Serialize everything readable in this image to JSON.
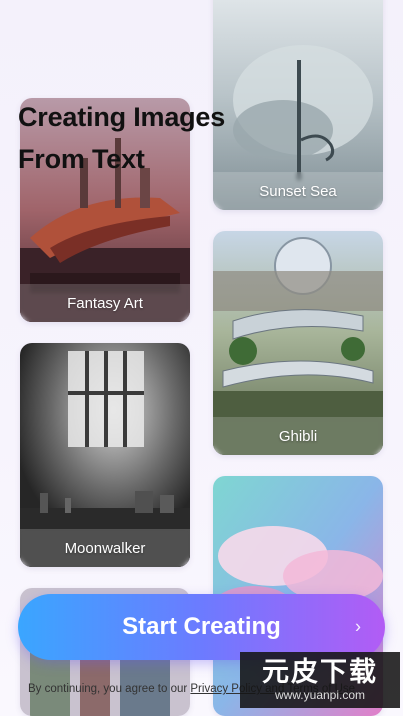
{
  "header": {
    "title_line1": "Creating Images",
    "title_line2": "From Text"
  },
  "styles": [
    {
      "label": "Fantasy Art"
    },
    {
      "label": "Moonwalker"
    },
    {
      "label": "Sunset Sea"
    },
    {
      "label": "Ghibli"
    }
  ],
  "cta": {
    "label": "Start Creating",
    "icon": "chevron-right-icon"
  },
  "footer": {
    "prefix": "By continuing, you agree to our ",
    "privacy_link": "Privacy Policy and Terms of Use"
  },
  "watermark": {
    "text": "元皮下载",
    "url": "www.yuanpi.com"
  },
  "colors": {
    "cta_start": "#3aa6ff",
    "cta_end": "#b25cf5",
    "headline": "#111111"
  }
}
